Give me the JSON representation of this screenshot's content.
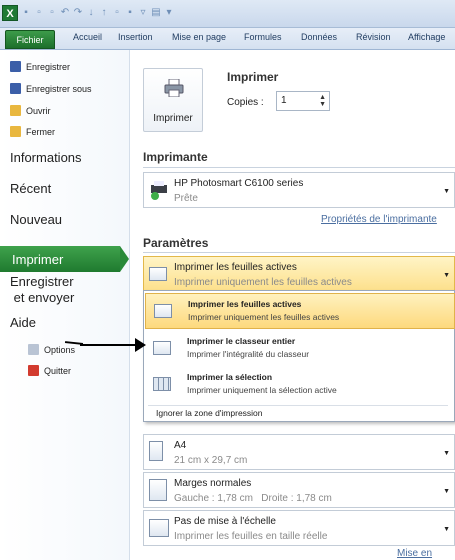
{
  "ribbon": {
    "tabs": [
      "Fichier",
      "Accueil",
      "Insertion",
      "Mise en page",
      "Formules",
      "Données",
      "Révision",
      "Affichage"
    ]
  },
  "backstage": {
    "commands": [
      {
        "label": "Enregistrer",
        "icon": "save-icon"
      },
      {
        "label": "Enregistrer sous",
        "icon": "save-as-icon"
      },
      {
        "label": "Ouvrir",
        "icon": "open-folder-icon"
      },
      {
        "label": "Fermer",
        "icon": "close-folder-icon"
      }
    ],
    "nav": [
      "Informations",
      "Récent",
      "Nouveau",
      "Imprimer",
      "Enregistrer\n et envoyer",
      "Aide"
    ],
    "active": "Imprimer",
    "lower_commands": [
      {
        "label": "Options",
        "icon": "options-icon"
      },
      {
        "label": "Quitter",
        "icon": "exit-icon"
      }
    ]
  },
  "print": {
    "title": "Imprimer",
    "button_label": "Imprimer",
    "copies_label": "Copies :",
    "copies_value": "1",
    "printer_section": "Imprimante",
    "printer_name": "HP Photosmart C6100 series",
    "printer_status": "Prête",
    "printer_props_link": "Propriétés de l'imprimante",
    "settings_section": "Paramètres",
    "selected_option": {
      "title": "Imprimer les feuilles actives",
      "subtitle": "Imprimer uniquement les feuilles actives"
    },
    "dropdown": [
      {
        "title": "Imprimer les feuilles actives",
        "subtitle": "Imprimer uniquement les feuilles actives"
      },
      {
        "title": "Imprimer le classeur entier",
        "subtitle": "Imprimer l'intégralité du classeur"
      },
      {
        "title": "Imprimer la sélection",
        "subtitle": "Imprimer uniquement la sélection active"
      }
    ],
    "ignore_area": "Ignorer la zone d'impression",
    "paper": {
      "title": "A4",
      "subtitle": "21 cm x 29,7 cm"
    },
    "margins": {
      "title": "Marges normales",
      "subtitle": "Gauche : 1,78 cm   Droite : 1,78 cm"
    },
    "scaling": {
      "title": "Pas de mise à l'échelle",
      "subtitle": "Imprimer les feuilles en taille réelle"
    },
    "page_setup_link": "Mise en page"
  },
  "colors": {
    "accent": "#2a8a39",
    "highlight": "#fde08b"
  }
}
